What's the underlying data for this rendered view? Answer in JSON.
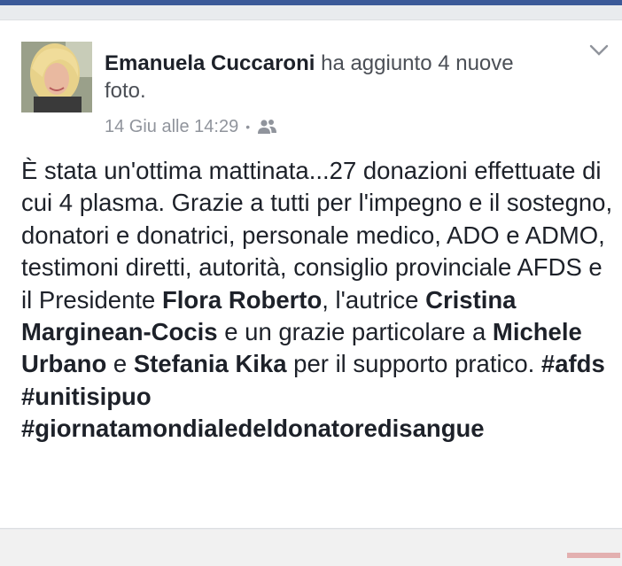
{
  "post": {
    "author": "Emanuela Cuccaroni",
    "action": "ha aggiunto 4 nuove foto.",
    "timestamp": "14 Giu alle 14:29",
    "separator": "•",
    "audience_icon": "friends-icon",
    "options_icon": "chevron-down-icon",
    "body": {
      "t1": "È stata un'ottima mattinata...27 donazioni effettuate di cui 4 plasma. Grazie a tutti per l'impegno e il sostegno, donatori e donatrici, personale medico, ADO e ADMO, testimoni diretti, autorità, consiglio provinciale AFDS e il Presidente ",
      "b1": "Flora Roberto",
      "t2": ", l'autrice ",
      "b2": "Cristina Marginean-Cocis",
      "t3": " e un grazie particolare a ",
      "b3": "Michele Urbano",
      "t4": " e ",
      "b4": "Stefania Kika",
      "t5": " per il supporto pratico. ",
      "h1": "#afds",
      "s1": " ",
      "h2": "#unitisipuo",
      "s2": " ",
      "h3": "#giornatamondialedeldonatoredisangue"
    }
  },
  "colors": {
    "facebook_blue": "#3b5998",
    "text": "#1d2129",
    "secondary_text": "#90949c"
  }
}
